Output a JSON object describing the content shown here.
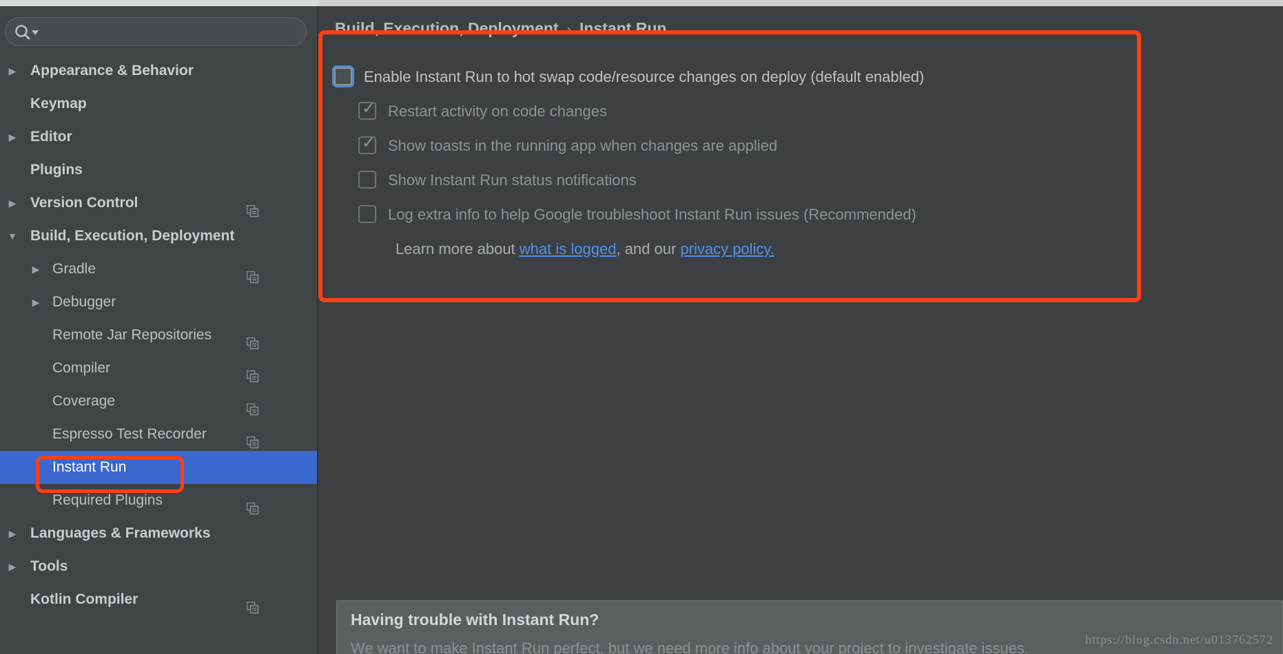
{
  "colors": {
    "accent_red": "#ff4013",
    "selection_blue": "#3a68cf",
    "link_blue": "#4e92ea",
    "sidebar_bg": "#3f4447",
    "main_bg": "#3c4043",
    "panel_bg": "#5a5f62"
  },
  "search": {
    "value": "",
    "placeholder": "",
    "icon": "search-icon"
  },
  "sidebar": {
    "items": [
      {
        "label": "Appearance & Behavior",
        "level": 0,
        "arrow": "collapsed",
        "bold": true,
        "copy_icon": false,
        "selected": false
      },
      {
        "label": "Keymap",
        "level": 0,
        "arrow": "none",
        "bold": true,
        "copy_icon": false,
        "selected": false
      },
      {
        "label": "Editor",
        "level": 0,
        "arrow": "collapsed",
        "bold": true,
        "copy_icon": false,
        "selected": false
      },
      {
        "label": "Plugins",
        "level": 0,
        "arrow": "none",
        "bold": true,
        "copy_icon": false,
        "selected": false
      },
      {
        "label": "Version Control",
        "level": 0,
        "arrow": "collapsed",
        "bold": true,
        "copy_icon": true,
        "selected": false
      },
      {
        "label": "Build, Execution, Deployment",
        "level": 0,
        "arrow": "expanded",
        "bold": true,
        "copy_icon": false,
        "selected": false
      },
      {
        "label": "Gradle",
        "level": 1,
        "arrow": "collapsed",
        "bold": false,
        "copy_icon": true,
        "selected": false
      },
      {
        "label": "Debugger",
        "level": 1,
        "arrow": "collapsed",
        "bold": false,
        "copy_icon": false,
        "selected": false
      },
      {
        "label": "Remote Jar Repositories",
        "level": 1,
        "arrow": "none",
        "bold": false,
        "copy_icon": true,
        "selected": false
      },
      {
        "label": "Compiler",
        "level": 1,
        "arrow": "none",
        "bold": false,
        "copy_icon": true,
        "selected": false
      },
      {
        "label": "Coverage",
        "level": 1,
        "arrow": "none",
        "bold": false,
        "copy_icon": true,
        "selected": false
      },
      {
        "label": "Espresso Test Recorder",
        "level": 1,
        "arrow": "none",
        "bold": false,
        "copy_icon": true,
        "selected": false
      },
      {
        "label": "Instant Run",
        "level": 1,
        "arrow": "none",
        "bold": false,
        "copy_icon": false,
        "selected": true
      },
      {
        "label": "Required Plugins",
        "level": 1,
        "arrow": "none",
        "bold": false,
        "copy_icon": true,
        "selected": false
      },
      {
        "label": "Languages & Frameworks",
        "level": 0,
        "arrow": "collapsed",
        "bold": true,
        "copy_icon": false,
        "selected": false
      },
      {
        "label": "Tools",
        "level": 0,
        "arrow": "collapsed",
        "bold": true,
        "copy_icon": false,
        "selected": false
      },
      {
        "label": "Kotlin Compiler",
        "level": 0,
        "arrow": "none",
        "bold": true,
        "copy_icon": true,
        "selected": false
      }
    ]
  },
  "breadcrumb": {
    "root": "Build, Execution, Deployment",
    "separator": "›",
    "current": "Instant Run"
  },
  "options": [
    {
      "label": "Enable Instant Run to hot swap code/resource changes on deploy (default enabled)",
      "checked": false,
      "disabled": false,
      "focused": true,
      "indent": "main"
    },
    {
      "label": "Restart activity on code changes",
      "checked": true,
      "disabled": true,
      "focused": false,
      "indent": "sub"
    },
    {
      "label": "Show toasts in the running app when changes are applied",
      "checked": true,
      "disabled": true,
      "focused": false,
      "indent": "sub"
    },
    {
      "label": "Show Instant Run status notifications",
      "checked": false,
      "disabled": true,
      "focused": false,
      "indent": "sub"
    },
    {
      "label": "Log extra info to help Google troubleshoot Instant Run issues (Recommended)",
      "checked": false,
      "disabled": true,
      "focused": false,
      "indent": "sub"
    }
  ],
  "learn_more": {
    "prefix": "Learn more about ",
    "link1": "what is logged",
    "middle": ", and our ",
    "link2": "privacy policy.",
    "suffix": ""
  },
  "bottom_panel": {
    "title": "Having trouble with Instant Run?",
    "body": "We want to make Instant Run perfect, but we need more info about your project to investigate issues."
  },
  "watermark": {
    "text": "https://blog.csdn.net/u013762572"
  }
}
